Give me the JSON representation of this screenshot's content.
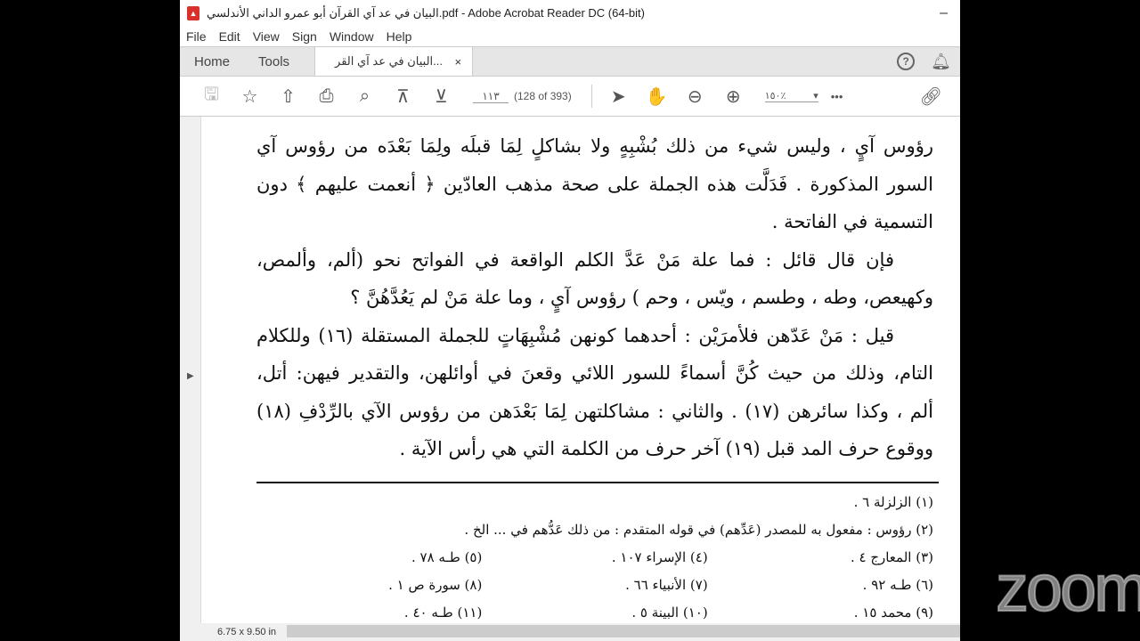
{
  "window": {
    "title": "البيان في عد آي القرآن أبو عمرو الداني الأندلسي.pdf - Adobe Acrobat Reader DC (64-bit)",
    "minimize": "–"
  },
  "menu": [
    "File",
    "Edit",
    "View",
    "Sign",
    "Window",
    "Help"
  ],
  "tabs": {
    "home": "Home",
    "tools": "Tools",
    "doc": "البيان في عد آي القر...",
    "close": "×"
  },
  "toolbar": {
    "page_input": "١١٣",
    "page_count": "(128 of 393)",
    "zoom": "١٥٠٪",
    "more": "•••"
  },
  "body_lines": [
    "رؤوس آيٍ ، وليس شيء من ذلك بُشْبِهٍ ولا بشاكلٍ لِمَا قبلَه ولِمَا بَعْدَه من رؤوس آي",
    "السور المذكورة . فَدَلَّت هذه الجملة على صحة مذهب العادّين ﴿ أنعمت عليهم ﴾ دون",
    "التسمية في الفاتحة .",
    "فإن قال قائل : فما علة مَنْ عَدَّ الكلم الواقعة في الفواتح نحو (ألم، وألمص،",
    "وكهيعص، وطه ، وطسم ، ويّس ، وحم ) رؤوس آيٍ ، وما علة مَنْ لم يَعُدَّهُنَّ ؟",
    "قيل : مَنْ عَدّهن فلأمرَيْن : أحدهما كونهن مُشْبِهَاتٍ للجملة المستقلة (١٦) وللكلام",
    "التام، وذلك من حيث كُنَّ أسماءً للسور اللائي وقعنَ في أوائلهن، والتقدير فيهن: أتل،",
    "ألم ، وكذا سائرهن (١٧) . والثاني : مشاكلتهن لِمَا بَعْدَهن من رؤوس الآي بالرِّدْفِ (١٨)",
    "ووقوع حرف المد قبل (١٩) آخر حرف من الكلمة التي هي رأس الآية ."
  ],
  "footnotes": {
    "n1": "(١)  الزلزلة ٦ .",
    "n2": "(٢)  رؤوس : مفعول به للمصدر (عَدِّهم) في قوله المتقدم : من ذلك عَدُّهم في ... الخ .",
    "n3": "(٣)  المعارج ٤ .",
    "n4": "(٤)  الإسراء ١٠٧ .",
    "n5": "(٥)  طـه ٧٨ .",
    "n6": "(٦)  طـه ٩٢ .",
    "n7": "(٧)  الأنبياء ٦٦ .",
    "n8": "(٨)  سورة ص ١ .",
    "n9": "(٩)  محمد ١٥ .",
    "n10": "(١٠)  البينة ٥ .",
    "n11": "(١١)  طـه ٤٠ ."
  },
  "status": {
    "page_size": "6.75 x 9.50 in"
  },
  "overlay": {
    "logo": "zoom"
  }
}
